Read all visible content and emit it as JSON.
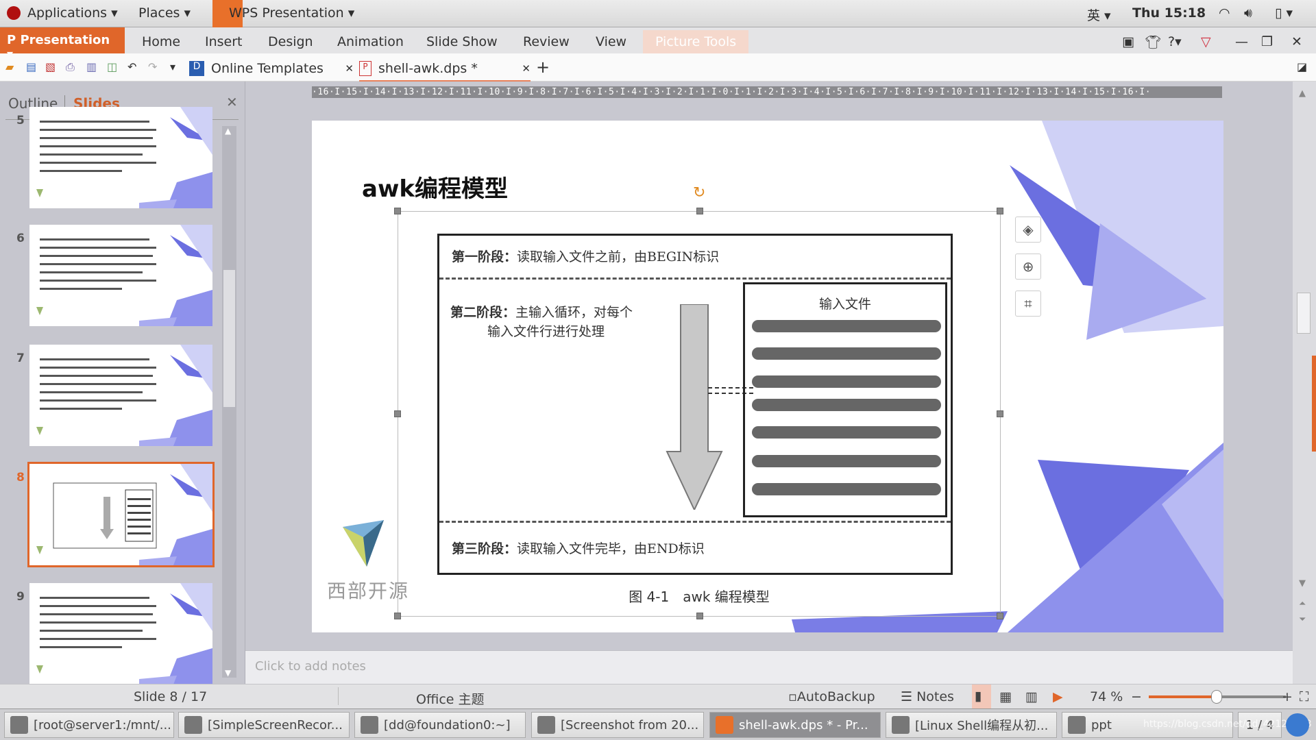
{
  "topbar": {
    "applications": "Applications",
    "places": "Places",
    "app": "WPS Presentation",
    "ime": "英",
    "clock": "Thu 15:18"
  },
  "ribbon": {
    "app_menu": "Presentation",
    "tabs": [
      "Home",
      "Insert",
      "Design",
      "Animation",
      "Slide Show",
      "Review",
      "View",
      "Picture Tools"
    ]
  },
  "toolbar": {
    "doc_tabs": [
      {
        "label": "Online Templates"
      },
      {
        "label": "shell-awk.dps *"
      }
    ]
  },
  "panel": {
    "tabs": [
      "Outline",
      "Slides"
    ],
    "active_tab": "Slides",
    "slide_numbers": [
      "5",
      "6",
      "7",
      "8",
      "9"
    ],
    "selected": "8"
  },
  "ruler": {
    "text": "·16·I·15·I·14·I·13·I·12·I·11·I·10·I·9·I·8·I·7·I·6·I·5·I·4·I·3·I·2·I·1·I·0·I·1·I·2·I·3·I·4·I·5·I·6·I·7·I·8·I·9·I·10·I·11·I·12·I·13·I·14·I·15·I·16·I·"
  },
  "slide": {
    "title": "awk编程模型",
    "stage1_label": "第一阶段：",
    "stage1_text": "读取输入文件之前，由BEGIN标识",
    "stage2_label": "第二阶段：",
    "stage2_text1": "主输入循环，对每个",
    "stage2_text2": "输入文件行进行处理",
    "input_file": "输入文件",
    "stage3_label": "第三阶段：",
    "stage3_text": "读取输入文件完毕，由END标识",
    "caption": "图 4-1　awk 编程模型",
    "logo_text": "西部开源",
    "accent": "#6b6fe0"
  },
  "notes": {
    "placeholder": "Click to add notes"
  },
  "status": {
    "slide": "Slide 8 / 17",
    "theme": "Office 主题",
    "autobackup": "AutoBackup",
    "notes": "Notes",
    "zoom": "74 %",
    "zoom_percent": 74
  },
  "taskbar": {
    "items": [
      "[root@server1:/mnt/...",
      "[SimpleScreenRecor...",
      "[dd@foundation0:~]",
      "[Screenshot from 20...",
      "shell-awk.dps * - Pr...",
      "[Linux Shell编程从初...",
      "ppt"
    ],
    "pager": "1 / 4",
    "watermark": "https://blog.csdn.net/dd_42124423"
  }
}
